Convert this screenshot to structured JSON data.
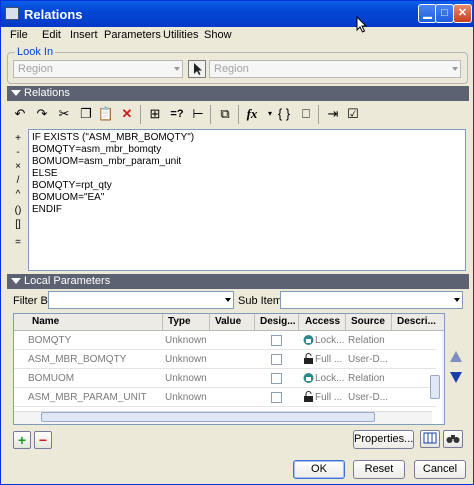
{
  "window": {
    "title": "Relations"
  },
  "menu": [
    "File",
    "Edit",
    "Insert",
    "Parameters",
    "Utilities",
    "Show"
  ],
  "look_in": {
    "label": "Look In",
    "type_value": "Region",
    "item_value": "Region"
  },
  "relations_section": {
    "label": "Relations"
  },
  "editor": {
    "lines": [
      "IF EXISTS (\"ASM_MBR_BOMQTY\")",
      "BOMQTY=asm_mbr_bomqty",
      "BOMUOM=asm_mbr_param_unit",
      "ELSE",
      "BOMQTY=rpt_qty",
      "BOMUOM=\"EA\"",
      "ENDIF"
    ]
  },
  "side_tools": [
    "+",
    "-",
    "×",
    "/",
    "^",
    "()",
    "[]",
    "="
  ],
  "local_section": {
    "label": "Local Parameters"
  },
  "filter": {
    "label": "Filter By",
    "value": "",
    "sub_items_label": "Sub Items",
    "sub_items_value": ""
  },
  "table": {
    "columns": [
      "Name",
      "Type",
      "Value",
      "Desig...",
      "Access",
      "Source",
      "Descri..."
    ],
    "rows": [
      {
        "name": "BOMQTY",
        "type": "Unknown",
        "value": "",
        "access": "Lock...",
        "source": "Relation"
      },
      {
        "name": "ASM_MBR_BOMQTY",
        "type": "Unknown",
        "value": "",
        "access": "Full ...",
        "source": "User-D..."
      },
      {
        "name": "BOMUOM",
        "type": "Unknown",
        "value": "",
        "access": "Lock...",
        "source": "Relation"
      },
      {
        "name": "ASM_MBR_PARAM_UNIT",
        "type": "Unknown",
        "value": "",
        "access": "Full ...",
        "source": "User-D..."
      }
    ]
  },
  "buttons": {
    "add": "+",
    "remove": "−",
    "properties": "Properties...",
    "ok": "OK",
    "reset": "Reset",
    "cancel": "Cancel"
  },
  "colors": {
    "titlebar": "#0347d4",
    "section_header": "#5c6271",
    "add_green": "#1f9a1f",
    "remove_red": "#c81e1e"
  }
}
